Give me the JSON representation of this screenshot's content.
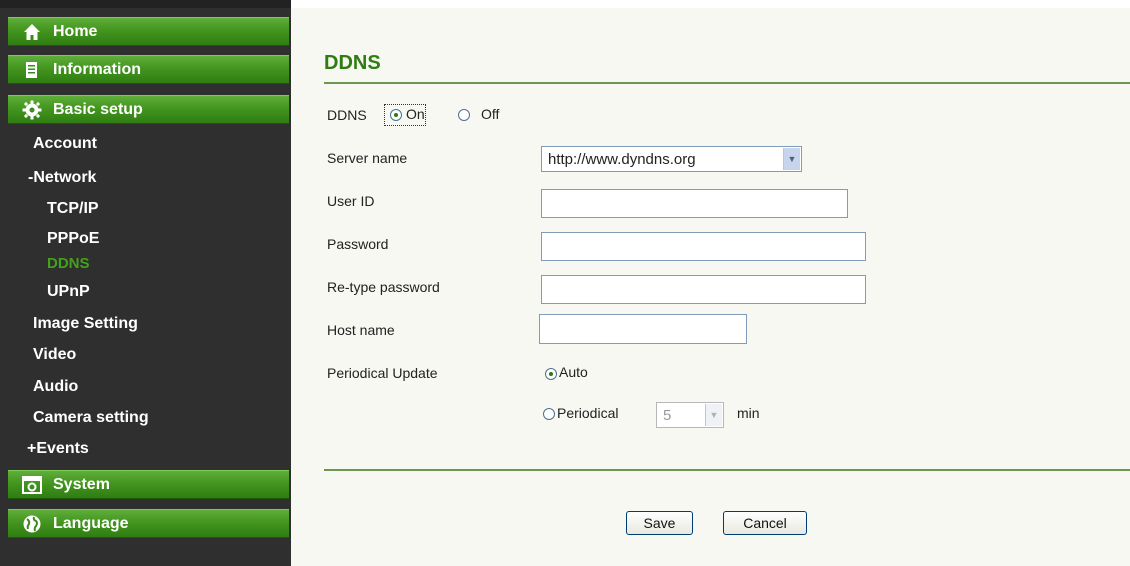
{
  "sidebar": {
    "main_items": [
      {
        "label": "Home",
        "icon": "home-icon"
      },
      {
        "label": "Information",
        "icon": "document-icon"
      },
      {
        "label": "Basic setup",
        "icon": "gear-icon"
      },
      {
        "label": "System",
        "icon": "system-icon"
      },
      {
        "label": "Language",
        "icon": "globe-icon"
      }
    ],
    "sub_items": {
      "account": "Account",
      "network": "-Network",
      "tcpip": "TCP/IP",
      "pppoe": "PPPoE",
      "ddns": "DDNS",
      "upnp": "UPnP",
      "image_setting": "Image Setting",
      "video": "Video",
      "audio": "Audio",
      "camera_setting": "Camera setting",
      "events": "+Events"
    }
  },
  "main": {
    "title": "DDNS",
    "ddns_label": "DDNS",
    "ddns_on": "On",
    "ddns_off": "Off",
    "ddns_selected": "On",
    "server_name_label": "Server name",
    "server_name_value": "http://www.dyndns.org",
    "user_id_label": "User ID",
    "user_id_value": "",
    "password_label": "Password",
    "password_value": "",
    "retype_password_label": "Re-type password",
    "retype_password_value": "",
    "host_name_label": "Host name",
    "host_name_value": "",
    "periodical_update_label": "Periodical Update",
    "auto_label": "Auto",
    "periodical_label": "Periodical",
    "periodical_value": "5",
    "min_label": "min",
    "update_selected": "Auto",
    "save_label": "Save",
    "cancel_label": "Cancel"
  },
  "colors": {
    "accent_green": "#2f7d12",
    "active_menu": "#43a11c",
    "sidebar_bg": "#2f2f2f",
    "content_bg": "#f6f8f1"
  }
}
